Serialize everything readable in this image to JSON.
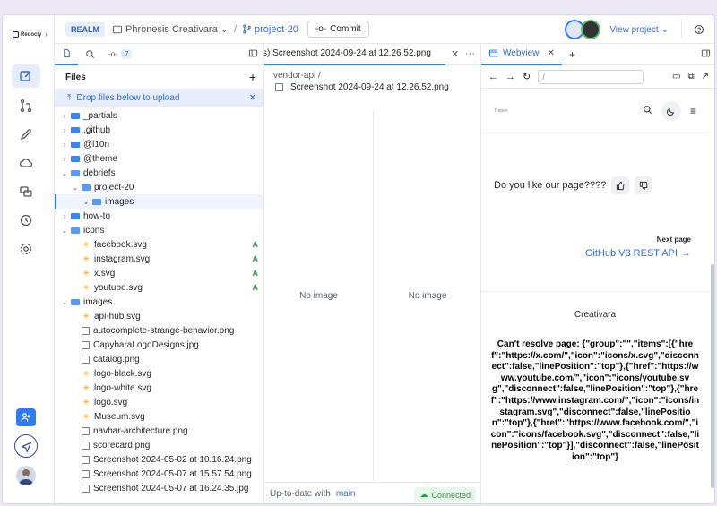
{
  "app": {
    "brand": "Redocly",
    "realm_badge": "REALM",
    "project_name": "Phronesis Creativara",
    "branch": "project-20",
    "commit_label": "Commit",
    "view_project_label": "View project"
  },
  "files_panel": {
    "changes_count": "7",
    "title": "Files",
    "drop_hint": "Drop files below to upload",
    "tree": [
      {
        "label": "_partials",
        "kind": "folder",
        "depth": 0,
        "open": false
      },
      {
        "label": ".github",
        "kind": "folder",
        "depth": 0,
        "open": false
      },
      {
        "label": "@l10n",
        "kind": "folder",
        "depth": 0,
        "open": false
      },
      {
        "label": "@theme",
        "kind": "folder",
        "depth": 0,
        "open": false
      },
      {
        "label": "debriefs",
        "kind": "folder",
        "depth": 0,
        "open": true
      },
      {
        "label": "project-20",
        "kind": "folder",
        "depth": 1,
        "open": true
      },
      {
        "label": "images",
        "kind": "folder",
        "depth": 2,
        "open": true,
        "selected": true
      },
      {
        "label": "how-to",
        "kind": "folder",
        "depth": 0,
        "open": false
      },
      {
        "label": "icons",
        "kind": "folder",
        "depth": 0,
        "open": true
      },
      {
        "label": "facebook.svg",
        "kind": "svg",
        "depth": 1,
        "status": "A"
      },
      {
        "label": "instagram.svg",
        "kind": "svg",
        "depth": 1,
        "status": "A"
      },
      {
        "label": "x.svg",
        "kind": "svg",
        "depth": 1,
        "status": "A"
      },
      {
        "label": "youtube.svg",
        "kind": "svg",
        "depth": 1,
        "status": "A"
      },
      {
        "label": "images",
        "kind": "folder",
        "depth": 0,
        "open": true
      },
      {
        "label": "api-hub.svg",
        "kind": "svg",
        "depth": 1
      },
      {
        "label": "autocomplete-strange-behavior.png",
        "kind": "img",
        "depth": 1
      },
      {
        "label": "CapybaraLogoDesigns.jpg",
        "kind": "img",
        "depth": 1
      },
      {
        "label": "catalog.png",
        "kind": "img",
        "depth": 1
      },
      {
        "label": "logo-black.svg",
        "kind": "svg",
        "depth": 1
      },
      {
        "label": "logo-white.svg",
        "kind": "svg",
        "depth": 1
      },
      {
        "label": "logo.svg",
        "kind": "svg",
        "depth": 1
      },
      {
        "label": "Museum.svg",
        "kind": "svg",
        "depth": 1
      },
      {
        "label": "navbar-architecture.png",
        "kind": "img",
        "depth": 1
      },
      {
        "label": "scorecard.png",
        "kind": "img",
        "depth": 1
      },
      {
        "label": "Screenshot 2024-05-02 at 10.16.24.png",
        "kind": "img",
        "depth": 1
      },
      {
        "label": "Screenshot 2024-05-07 at 15.57.54.png",
        "kind": "img",
        "depth": 1
      },
      {
        "label": "Screenshot 2024-05-07 at 16.24.35.jpg",
        "kind": "img",
        "depth": 1
      }
    ]
  },
  "editor": {
    "tab_label": "s) Screenshot 2024-09-24 at 12.26.52.png",
    "breadcrumb": "vendor-api  /",
    "file_name": "Screenshot 2024-09-24 at 12.26.52.png",
    "left_pane": "No image",
    "right_pane": "No image",
    "status_text": "Up-to-date with",
    "status_branch": "main",
    "connection": "Connected"
  },
  "webview": {
    "tab_label": "Webview",
    "url_value": "/",
    "site_logo": "Trabex",
    "feedback_question": "Do you like our page????",
    "next_label": "Next page",
    "next_link": "GitHub V3 REST API",
    "footer_title": "Creativara",
    "error_message": "Can't resolve page: {\"group\":\"\",\"items\":[{\"href\":\"https://x.com/\",\"icon\":\"icons/x.svg\",\"disconnect\":false,\"linePosition\":\"top\"},{\"href\":\"https://www.youtube.com/\",\"icon\":\"icons/youtube.svg\",\"disconnect\":false,\"linePosition\":\"top\"},{\"href\":\"https://www.instagram.com/\",\"icon\":\"icons/instagram.svg\",\"disconnect\":false,\"linePosition\":\"top\"},{\"href\":\"https://www.facebook.com/\",\"icon\":\"icons/facebook.svg\",\"disconnect\":false,\"linePosition\":\"top\"}],\"disconnect\":false,\"linePosition\":\"top\"}"
  },
  "colors": {
    "accent": "#2f7cf6",
    "added": "#2ea043",
    "svg_icon": "#e8a317"
  }
}
